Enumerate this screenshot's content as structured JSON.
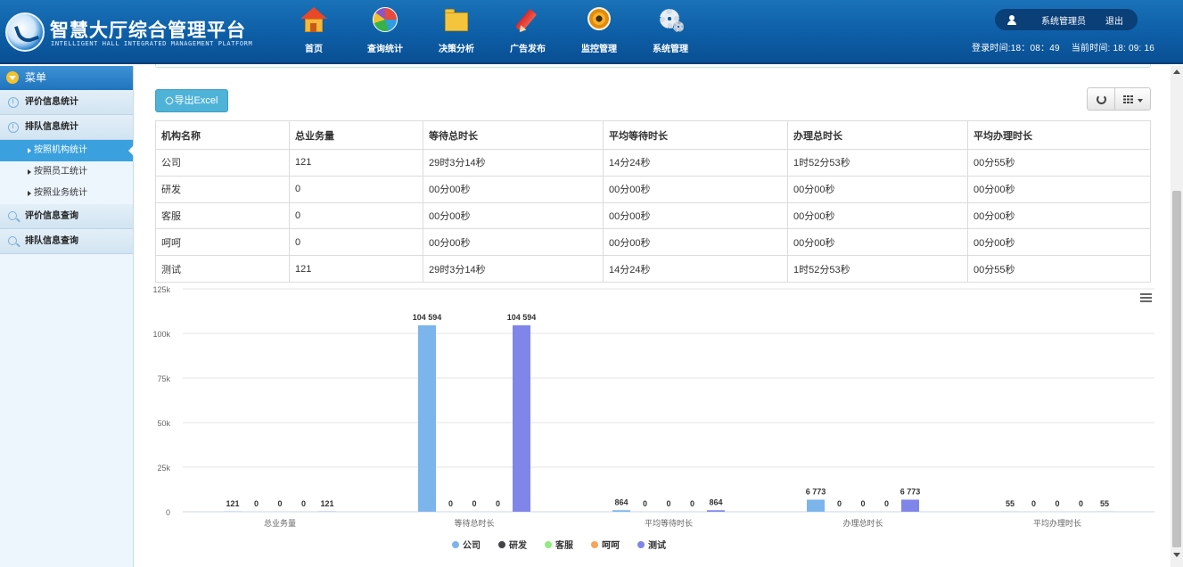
{
  "header": {
    "title": "智慧大厅综合管理平台",
    "subtitle": "INTELLIGENT HALL INTEGRATED MANAGEMENT PLATFORM",
    "nav": [
      {
        "label": "首页",
        "icon": "home-icon"
      },
      {
        "label": "查询统计",
        "icon": "pie-chart-icon"
      },
      {
        "label": "决策分析",
        "icon": "folder-icon"
      },
      {
        "label": "广告发布",
        "icon": "pencil-icon"
      },
      {
        "label": "监控管理",
        "icon": "camera-icon"
      },
      {
        "label": "系统管理",
        "icon": "gear-icon"
      }
    ],
    "user": "系统管理员",
    "logout": "退出",
    "login_time": "登录时间:18：08：49",
    "current_time": "当前时间: 18: 09: 16"
  },
  "sidebar": {
    "menu_title": "菜单",
    "items": [
      {
        "label": "评价信息统计",
        "type": "group",
        "icon": "clock-icon"
      },
      {
        "label": "排队信息统计",
        "type": "group",
        "icon": "clock-icon"
      },
      {
        "label": "按照机构统计",
        "type": "sub",
        "active": true
      },
      {
        "label": "按照员工统计",
        "type": "sub"
      },
      {
        "label": "按照业务统计",
        "type": "sub"
      },
      {
        "label": "评价信息查询",
        "type": "group",
        "icon": "search-icon"
      },
      {
        "label": "排队信息查询",
        "type": "group",
        "icon": "search-icon"
      }
    ]
  },
  "toolbar": {
    "export_label": "导出Excel"
  },
  "table": {
    "columns": [
      "机构名称",
      "总业务量",
      "等待总时长",
      "平均等待时长",
      "办理总时长",
      "平均办理时长"
    ],
    "rows": [
      [
        "公司",
        "121",
        "29时3分14秒",
        "14分24秒",
        "1时52分53秒",
        "00分55秒"
      ],
      [
        "研发",
        "0",
        "00分00秒",
        "00分00秒",
        "00分00秒",
        "00分00秒"
      ],
      [
        "客服",
        "0",
        "00分00秒",
        "00分00秒",
        "00分00秒",
        "00分00秒"
      ],
      [
        "呵呵",
        "0",
        "00分00秒",
        "00分00秒",
        "00分00秒",
        "00分00秒"
      ],
      [
        "测试",
        "121",
        "29时3分14秒",
        "14分24秒",
        "1时52分53秒",
        "00分55秒"
      ]
    ]
  },
  "chart_data": {
    "type": "bar",
    "categories": [
      "总业务量",
      "等待总时长",
      "平均等待时长",
      "办理总时长",
      "平均办理时长"
    ],
    "series": [
      {
        "name": "公司",
        "color": "#7cb5ec",
        "values": [
          121,
          104594,
          864,
          6773,
          55
        ]
      },
      {
        "name": "研发",
        "color": "#434348",
        "values": [
          0,
          0,
          0,
          0,
          0
        ]
      },
      {
        "name": "客服",
        "color": "#90ed7d",
        "values": [
          0,
          0,
          0,
          0,
          0
        ]
      },
      {
        "name": "呵呵",
        "color": "#f7a35c",
        "values": [
          0,
          0,
          0,
          0,
          0
        ]
      },
      {
        "name": "测试",
        "color": "#8085e9",
        "values": [
          121,
          104594,
          864,
          6773,
          55
        ]
      }
    ],
    "y_ticks": [
      "0",
      "25k",
      "50k",
      "75k",
      "100k",
      "125k"
    ],
    "ylim": [
      0,
      125000
    ],
    "grid": true,
    "legend_position": "bottom-center",
    "data_labels": true,
    "menu_icon": "hamburger-menu-icon"
  }
}
